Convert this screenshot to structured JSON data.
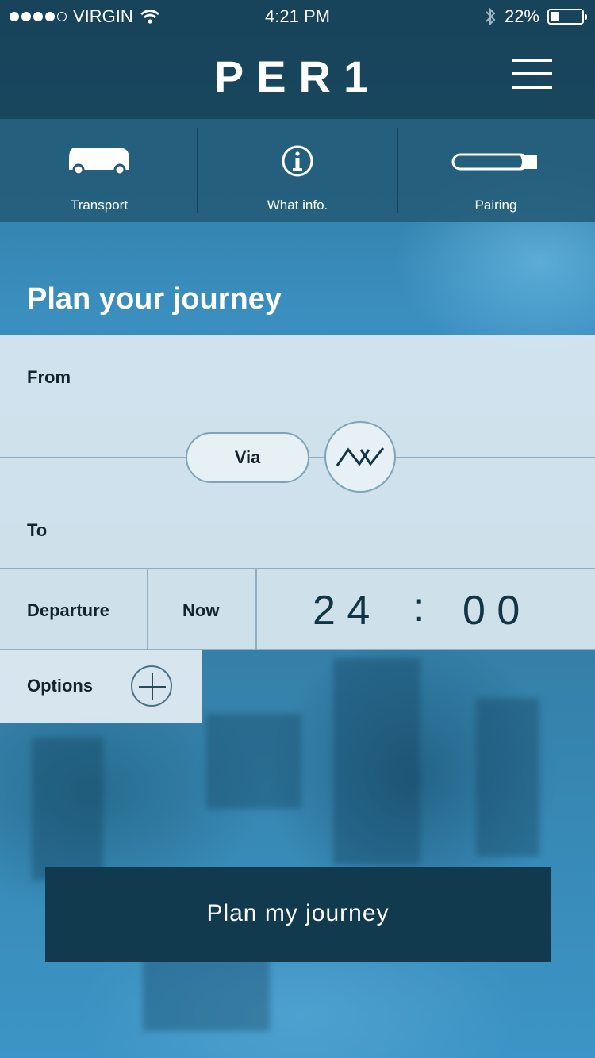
{
  "status_bar": {
    "carrier": "VIRGIN",
    "time": "4:21 PM",
    "battery": "22%",
    "signal_bars_filled": 4,
    "signal_bars_total": 5,
    "battery_level": 0.22
  },
  "header": {
    "logo": "PER1",
    "menu_icon": "hamburger-menu-icon"
  },
  "nav": {
    "items": [
      {
        "label": "Transport",
        "icon": "bus-icon"
      },
      {
        "label": "What info.",
        "icon": "info-icon"
      },
      {
        "label": "Pairing",
        "icon": "pen-device-icon"
      }
    ]
  },
  "page": {
    "title": "Plan your journey"
  },
  "form": {
    "from_label": "From",
    "via_label": "Via",
    "swap_icon": "swap-route-icon",
    "to_label": "To",
    "departure_label": "Departure",
    "now_label": "Now",
    "time_hours": "2 4",
    "time_sep": ":",
    "time_minutes": "0 0",
    "options_label": "Options",
    "options_icon": "plus-icon"
  },
  "cta": {
    "label": "Plan my journey"
  },
  "colors": {
    "header_bg": "#143a4e",
    "cta_bg": "#113a4f",
    "panel_bg": "#e4eef4",
    "text_dark": "#14232c"
  }
}
